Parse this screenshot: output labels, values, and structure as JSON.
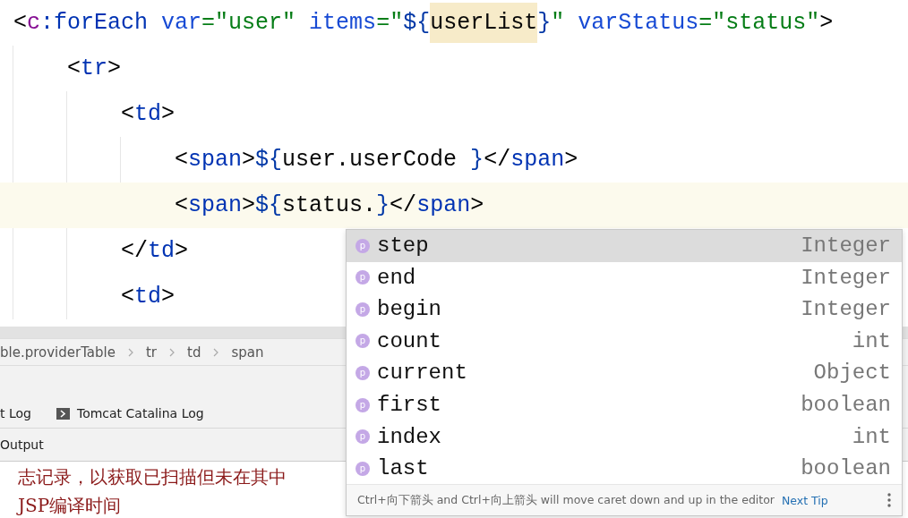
{
  "editor": {
    "lines": [
      {
        "current": false,
        "tokens": [
          {
            "text": "<",
            "kind": "bracket"
          },
          {
            "text": "c",
            "kind": "ns"
          },
          {
            "text": ":forEach",
            "kind": "tag"
          },
          {
            "text": " var",
            "kind": "attr"
          },
          {
            "text": "=\"user\"",
            "kind": "string"
          },
          {
            "text": " items",
            "kind": "attr"
          },
          {
            "text": "=\"",
            "kind": "string"
          },
          {
            "text": "${",
            "kind": "el"
          },
          {
            "text": "userList",
            "kind": "text",
            "highlight": true
          },
          {
            "text": "}",
            "kind": "el"
          },
          {
            "text": "\"",
            "kind": "string"
          },
          {
            "text": " varStatus",
            "kind": "attr"
          },
          {
            "text": "=\"status\"",
            "kind": "string"
          },
          {
            "text": ">",
            "kind": "bracket"
          }
        ],
        "children": [
          {
            "current": false,
            "tokens": [
              {
                "text": "<",
                "kind": "bracket"
              },
              {
                "text": "tr",
                "kind": "tag"
              },
              {
                "text": ">",
                "kind": "bracket"
              }
            ],
            "children": [
              {
                "current": false,
                "tokens": [
                  {
                    "text": "<",
                    "kind": "bracket"
                  },
                  {
                    "text": "td",
                    "kind": "tag"
                  },
                  {
                    "text": ">",
                    "kind": "bracket"
                  }
                ],
                "children": [
                  {
                    "current": false,
                    "tokens": [
                      {
                        "text": "<",
                        "kind": "bracket"
                      },
                      {
                        "text": "span",
                        "kind": "tag"
                      },
                      {
                        "text": ">",
                        "kind": "bracket"
                      },
                      {
                        "text": "${",
                        "kind": "el"
                      },
                      {
                        "text": "user.userCode ",
                        "kind": "text"
                      },
                      {
                        "text": "}",
                        "kind": "el"
                      },
                      {
                        "text": "</",
                        "kind": "bracket"
                      },
                      {
                        "text": "span",
                        "kind": "tag"
                      },
                      {
                        "text": ">",
                        "kind": "bracket"
                      }
                    ]
                  },
                  {
                    "current": true,
                    "tokens": [
                      {
                        "text": "<",
                        "kind": "bracket"
                      },
                      {
                        "text": "span",
                        "kind": "tag"
                      },
                      {
                        "text": ">",
                        "kind": "bracket"
                      },
                      {
                        "text": "${",
                        "kind": "el"
                      },
                      {
                        "text": "status.",
                        "kind": "text"
                      },
                      {
                        "text": "}",
                        "kind": "el"
                      },
                      {
                        "text": "</",
                        "kind": "bracket"
                      },
                      {
                        "text": "span",
                        "kind": "tag"
                      },
                      {
                        "text": ">",
                        "kind": "bracket"
                      }
                    ]
                  }
                ]
              },
              {
                "current": false,
                "tokens": [
                  {
                    "text": "</",
                    "kind": "bracket"
                  },
                  {
                    "text": "td",
                    "kind": "tag"
                  },
                  {
                    "text": ">",
                    "kind": "bracket"
                  }
                ]
              },
              {
                "current": false,
                "tokens": [
                  {
                    "text": "<",
                    "kind": "bracket"
                  },
                  {
                    "text": "td",
                    "kind": "tag"
                  },
                  {
                    "text": ">",
                    "kind": "bracket"
                  }
                ]
              }
            ]
          }
        ]
      }
    ]
  },
  "breadcrumbs": [
    "ble.providerTable",
    "tr",
    "td",
    "span"
  ],
  "tool_tabs": [
    {
      "label": "t Log",
      "icon": false
    },
    {
      "label": "Tomcat Catalina Log",
      "icon": true
    }
  ],
  "output_label": "Output",
  "page_text": [
    "志记录，以获取已扫描但未在其中",
    "JSP编译时间"
  ],
  "completion": {
    "items": [
      {
        "icon": "p",
        "name": "step",
        "type": "Integer",
        "selected": true
      },
      {
        "icon": "p",
        "name": "end",
        "type": "Integer",
        "selected": false
      },
      {
        "icon": "p",
        "name": "begin",
        "type": "Integer",
        "selected": false
      },
      {
        "icon": "p",
        "name": "count",
        "type": "int",
        "selected": false
      },
      {
        "icon": "p",
        "name": "current",
        "type": "Object",
        "selected": false
      },
      {
        "icon": "p",
        "name": "first",
        "type": "boolean",
        "selected": false
      },
      {
        "icon": "p",
        "name": "index",
        "type": "int",
        "selected": false
      },
      {
        "icon": "p",
        "name": "last",
        "type": "boolean",
        "selected": false
      }
    ],
    "hint": "Ctrl+向下箭头 and Ctrl+向上箭头 will move caret down and up in the editor",
    "hint_link": "Next Tip"
  }
}
